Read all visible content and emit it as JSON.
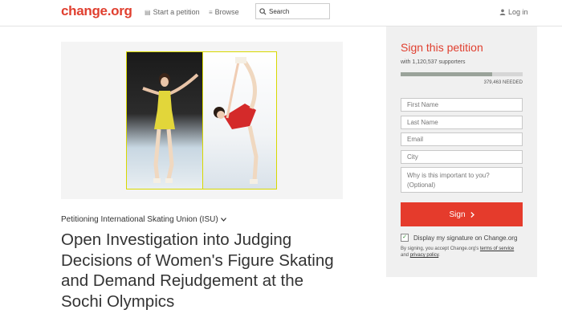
{
  "header": {
    "logo": "change.org",
    "start_petition": "Start a petition",
    "browse": "Browse",
    "search_placeholder": "Search",
    "login": "Log in"
  },
  "petition": {
    "petitioning": "Petitioning International Skating Union (ISU)",
    "title": "Open Investigation into Judging Decisions of Women's Figure Skating and Demand Rejudgement at the Sochi Olympics"
  },
  "sidebar": {
    "heading": "Sign this petition",
    "supporters": "with 1,120,537 supporters",
    "progress_fraction": 0.75,
    "needed": "379,463 NEEDED",
    "first_name_placeholder": "First Name",
    "last_name_placeholder": "Last Name",
    "email_placeholder": "Email",
    "city_placeholder": "City",
    "why_placeholder": "Why is this important to you? (Optional)",
    "sign_label": "Sign",
    "display_label": "Display my signature on Change.org",
    "terms_prefix": "By signing, you accept Change.org's",
    "terms_link": "terms of service",
    "terms_and": "and",
    "privacy_link": "privacy policy",
    "terms_end": "."
  },
  "colors": {
    "brand": "#e03f2f",
    "button": "#e53b2c"
  },
  "icons": {
    "start_petition": "megaphone-icon",
    "browse": "list-icon",
    "search": "search-icon",
    "login": "user-icon",
    "dropdown": "chevron-down-icon",
    "sign_arrow": "chevron-right-icon",
    "check": "check-icon"
  }
}
